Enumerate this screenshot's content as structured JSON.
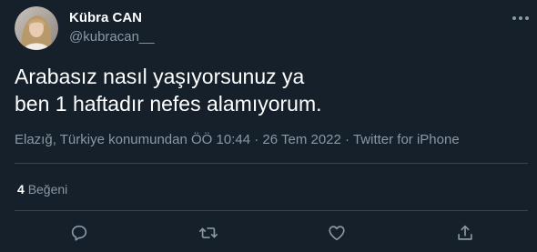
{
  "user": {
    "display_name": "Kübra CAN",
    "handle": "@kubracan__"
  },
  "icons": {
    "more": "more-icon",
    "reply": "reply-icon",
    "retweet": "retweet-icon",
    "like": "heart-icon",
    "share": "share-icon"
  },
  "tweet": {
    "lines": [
      "Arabasız nasıl yaşıyorsunuz ya",
      "ben 1 haftadır nefes alamıyorum."
    ]
  },
  "meta": {
    "location": "Elazığ, Türkiye konumundan",
    "time": "ÖÖ 10:44",
    "sep1": "·",
    "date": "26 Tem 2022",
    "sep2": "·",
    "source": "Twitter for iPhone"
  },
  "stats": {
    "likes_count": "4",
    "likes_label": "Beğeni"
  },
  "colors": {
    "background": "#15202b",
    "text_primary": "#ffffff",
    "text_secondary": "#8b98a5",
    "divider": "#38444d"
  }
}
